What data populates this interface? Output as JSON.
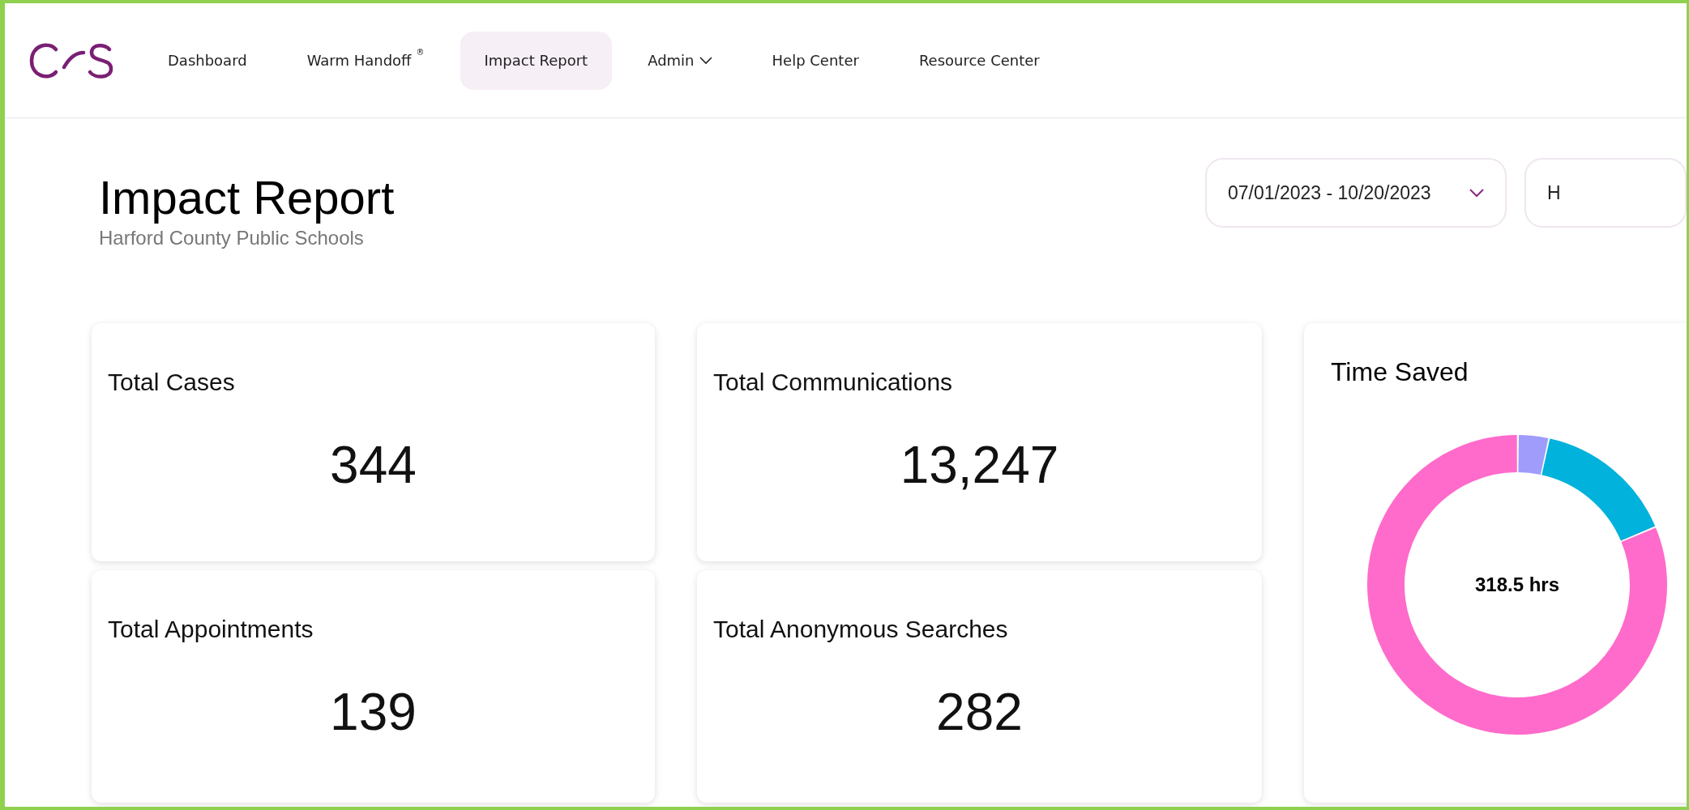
{
  "nav": {
    "items": [
      {
        "label": "Dashboard",
        "selected": false
      },
      {
        "label": "Warm Handoff",
        "sup": "®",
        "selected": false
      },
      {
        "label": "Impact Report",
        "selected": true
      },
      {
        "label": "Admin",
        "kind": "dropdown",
        "selected": false
      },
      {
        "label": "Help Center",
        "selected": false
      },
      {
        "label": "Resource Center",
        "selected": false
      }
    ]
  },
  "header": {
    "title": "Impact Report",
    "subtitle": "Harford County Public Schools",
    "date_range": "07/01/2023 - 10/20/2023",
    "filter_2": "H"
  },
  "stats": [
    {
      "label": "Total Cases",
      "value": "344"
    },
    {
      "label": "Total Communications",
      "value": "13,247"
    },
    {
      "label": "Total Appointments",
      "value": "139"
    },
    {
      "label": "Total Anonymous Searches",
      "value": "282"
    }
  ],
  "time_saved": {
    "title": "Time Saved",
    "total": "318.5 hrs"
  }
}
